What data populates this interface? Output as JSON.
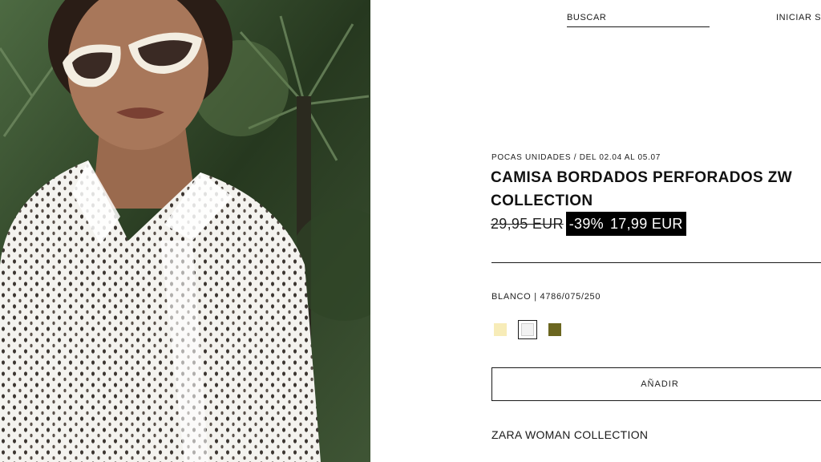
{
  "header": {
    "search_label": "BUSCAR",
    "login_label": "INICIAR SESIÓN"
  },
  "product": {
    "availability": "POCAS UNIDADES / DEL 02.04 AL 05.07",
    "title_line1": "CAMISA BORDADOS PERFORADOS ZW",
    "title_line2": "COLLECTION",
    "old_price": "29,95 EUR",
    "discount": "-39%",
    "new_price": "17,99 EUR",
    "color_reference": "BLANCO | 4786/075/250",
    "colors": [
      {
        "name": "cream-swatch",
        "hex": "#f7ecb8",
        "selected": false
      },
      {
        "name": "white-swatch",
        "hex": "#f2f2f2",
        "selected": true
      },
      {
        "name": "olive-swatch",
        "hex": "#6b6620",
        "selected": false
      }
    ],
    "add_label": "AÑADIR",
    "collection_label": "ZARA WOMAN COLLECTION"
  }
}
